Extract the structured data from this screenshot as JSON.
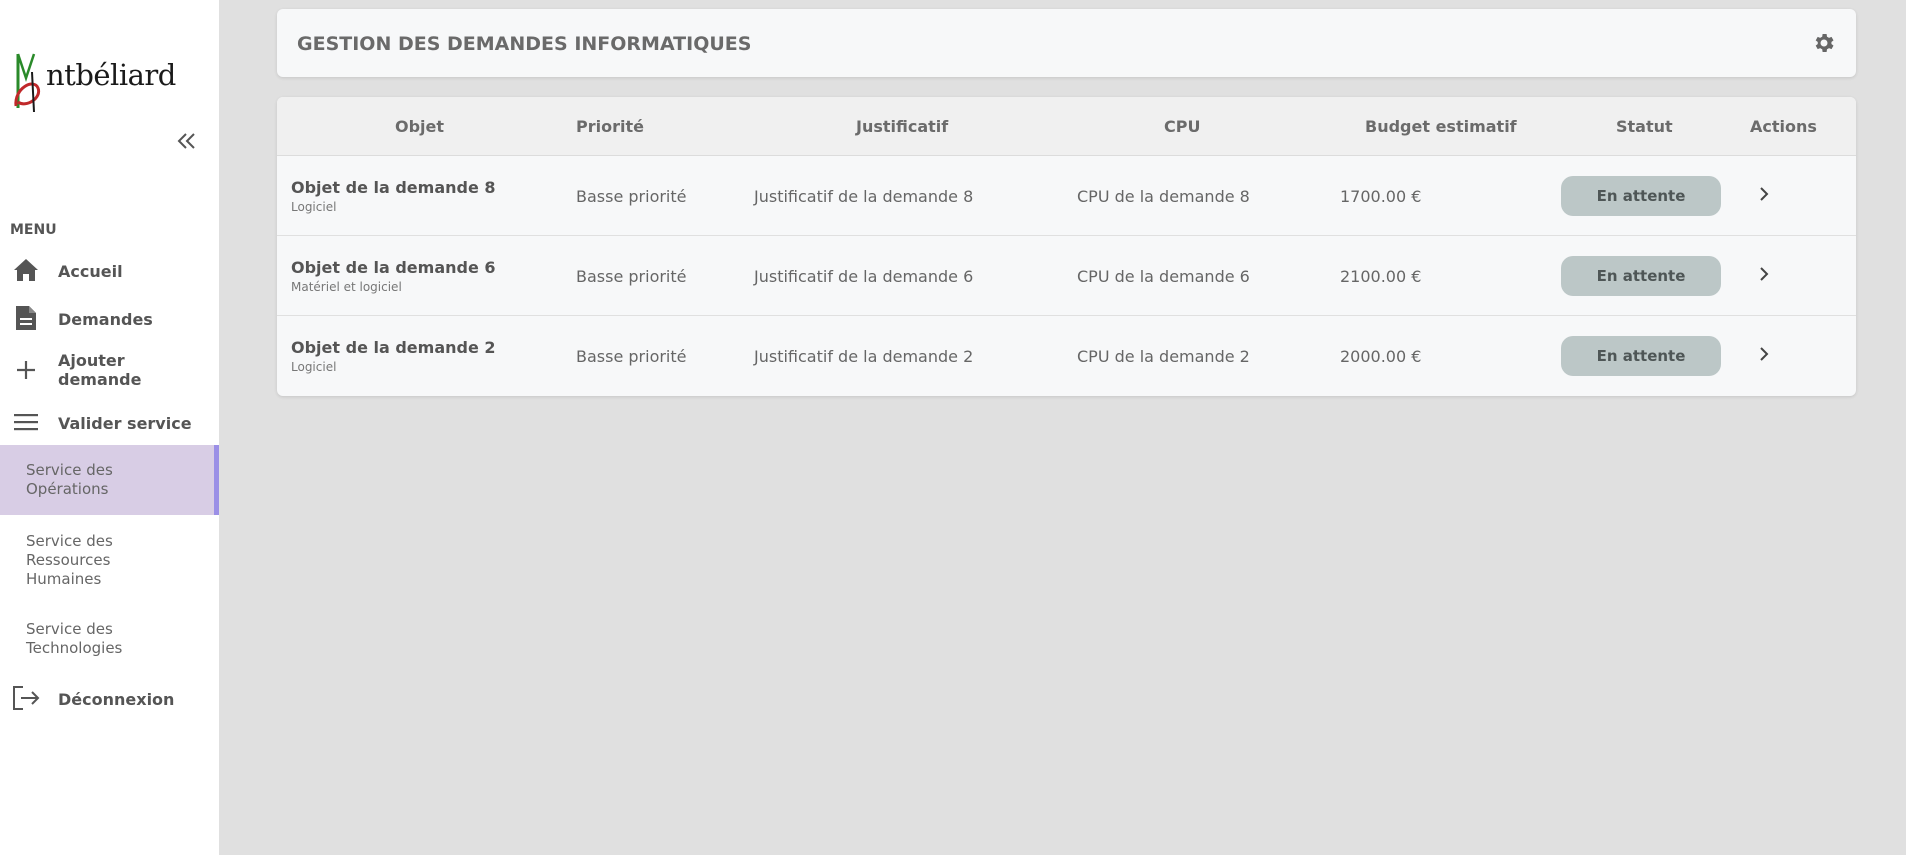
{
  "sidebar": {
    "logo_text": "ntbéliard",
    "menu_label": "MENU",
    "nav": [
      {
        "label": "Accueil",
        "icon": "home-icon"
      },
      {
        "label": "Demandes",
        "icon": "document-icon"
      },
      {
        "label": "Ajouter demande",
        "icon": "plus-icon"
      },
      {
        "label": "Valider service",
        "icon": "menu-icon"
      }
    ],
    "services": [
      {
        "label": "Service des Opérations",
        "active": true
      },
      {
        "label": "Service des Ressources Humaines",
        "active": false
      },
      {
        "label": "Service des Technologies",
        "active": false
      }
    ],
    "logout": {
      "label": "Déconnexion",
      "icon": "logout-icon"
    }
  },
  "header": {
    "title": "GESTION DES DEMANDES INFORMATIQUES",
    "settings_icon": "gear-icon"
  },
  "table": {
    "columns": [
      "Objet",
      "Priorité",
      "Justificatif",
      "CPU",
      "Budget estimatif",
      "Statut",
      "Actions"
    ],
    "rows": [
      {
        "objet": "Objet de la demande 8",
        "type": "Logiciel",
        "priorite": "Basse priorité",
        "justificatif": "Justificatif de la demande 8",
        "cpu": "CPU de la demande 8",
        "budget": "1700.00 €",
        "statut": "En attente"
      },
      {
        "objet": "Objet de la demande 6",
        "type": "Matériel et logiciel",
        "priorite": "Basse priorité",
        "justificatif": "Justificatif de la demande 6",
        "cpu": "CPU de la demande 6",
        "budget": "2100.00 €",
        "statut": "En attente"
      },
      {
        "objet": "Objet de la demande 2",
        "type": "Logiciel",
        "priorite": "Basse priorité",
        "justificatif": "Justificatif de la demande 2",
        "cpu": "CPU de la demande 2",
        "budget": "2000.00 €",
        "statut": "En attente"
      }
    ]
  },
  "colors": {
    "sidebar_bg": "#ffffff",
    "content_bg": "#e0e0e0",
    "active_service_bg": "#d8cde5",
    "active_service_accent": "#9b8fe6",
    "status_bg": "#bcc7c7"
  }
}
